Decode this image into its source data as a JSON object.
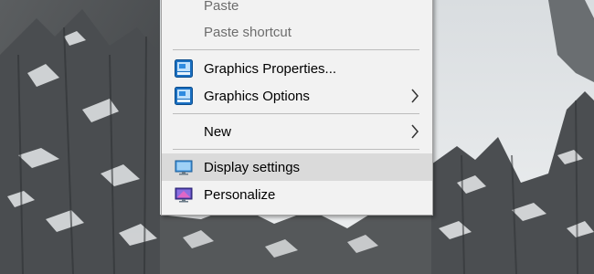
{
  "context_menu": {
    "items": [
      {
        "label": "Paste",
        "enabled": false
      },
      {
        "label": "Paste shortcut",
        "enabled": false
      },
      {
        "label": "Graphics Properties...",
        "icon": "intel-graphics-icon",
        "enabled": true
      },
      {
        "label": "Graphics Options",
        "icon": "intel-graphics-icon",
        "submenu": true,
        "enabled": true
      },
      {
        "label": "New",
        "submenu": true,
        "enabled": true
      },
      {
        "label": "Display settings",
        "icon": "display-monitor-icon",
        "highlighted": true,
        "enabled": true
      },
      {
        "label": "Personalize",
        "icon": "personalize-monitor-icon",
        "enabled": true
      }
    ]
  },
  "colors": {
    "menu_background": "#f2f2f2",
    "highlight": "#dadada",
    "disabled_text": "#6d6d6d",
    "separator": "#bdbdbd"
  }
}
